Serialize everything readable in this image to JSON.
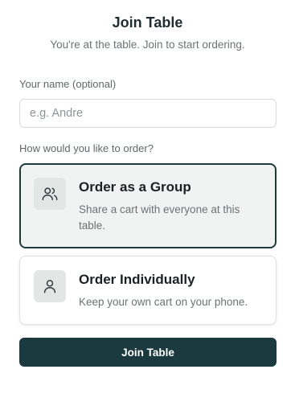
{
  "header": {
    "title": "Join Table",
    "subtitle": "You're at the table. Join to start ordering."
  },
  "name_field": {
    "label": "Your name (optional)",
    "placeholder": "e.g. Andre",
    "value": ""
  },
  "order_mode": {
    "question": "How would you like to order?",
    "selected": "group",
    "options": [
      {
        "id": "group",
        "icon": "users-icon",
        "title": "Order as a Group",
        "description": "Share a cart with everyone at this table."
      },
      {
        "id": "individual",
        "icon": "user-icon",
        "title": "Order Individually",
        "description": "Keep your own cart on your phone."
      }
    ]
  },
  "actions": {
    "join_label": "Join Table"
  },
  "colors": {
    "accent": "#1a3a40",
    "selected_bg": "#f1f3f2",
    "icon_bg": "#e2e6e5"
  }
}
